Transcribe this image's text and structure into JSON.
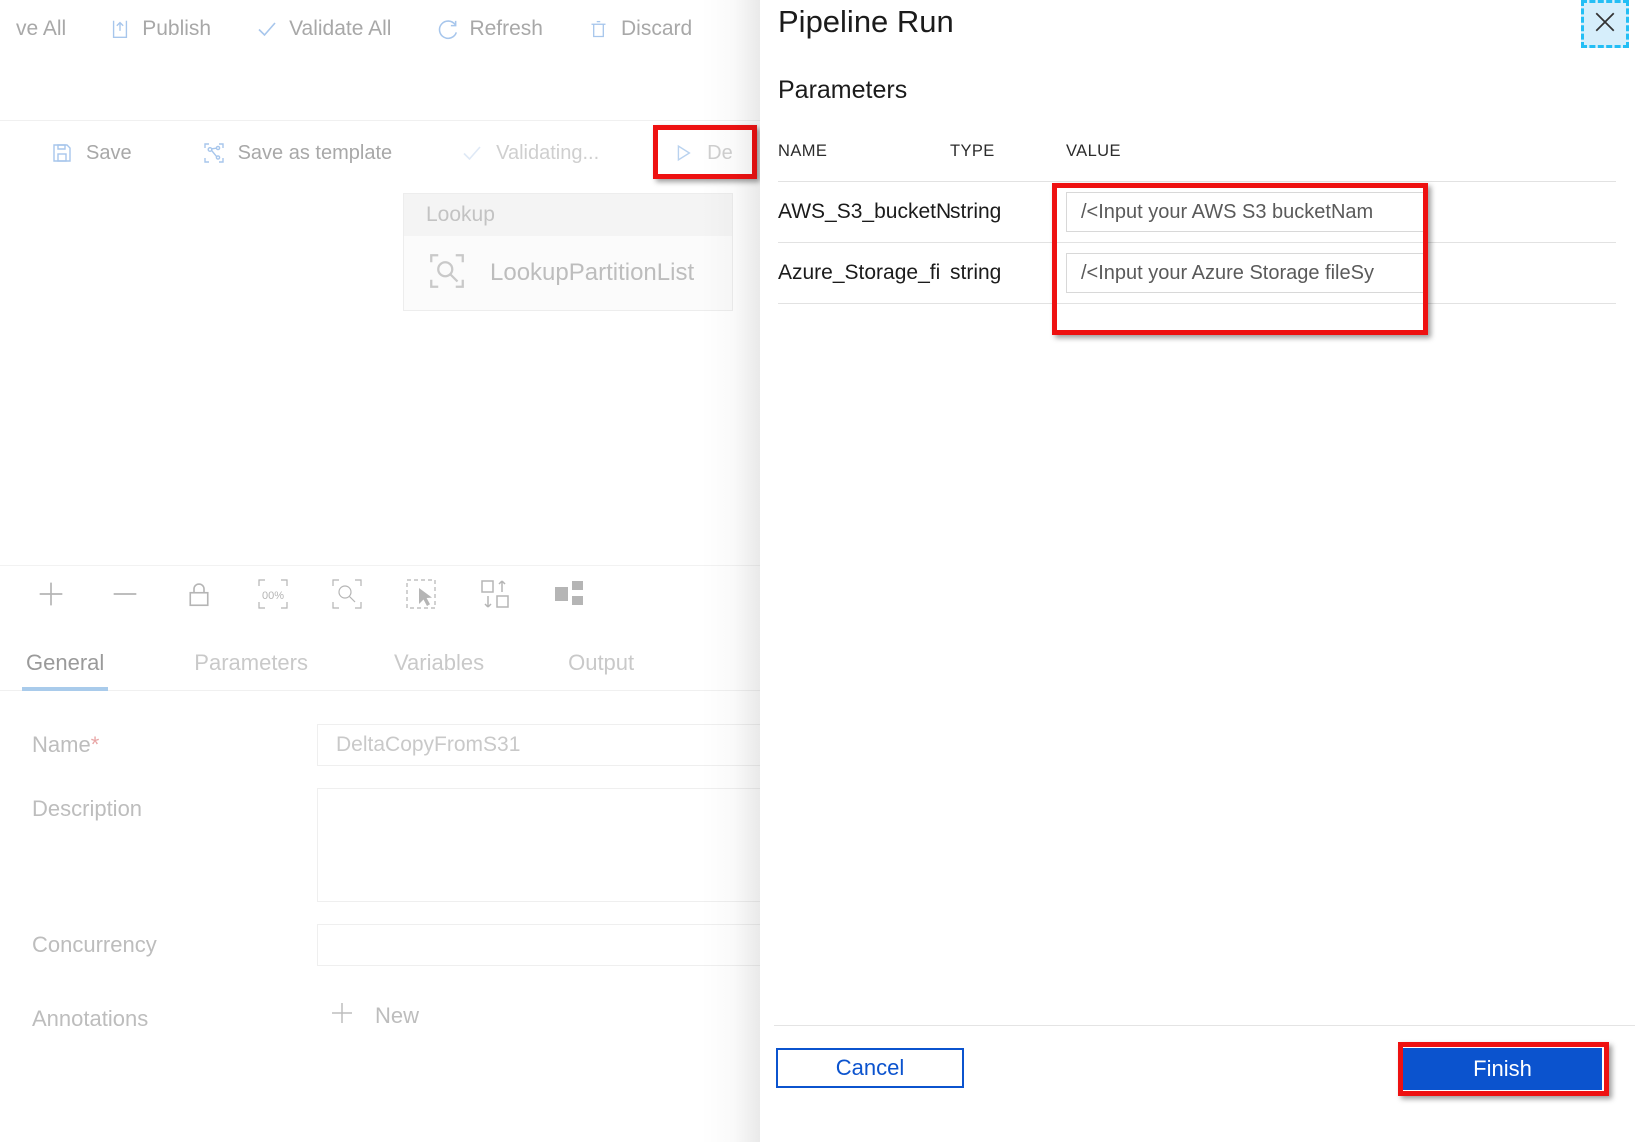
{
  "factory_toolbar": {
    "items": [
      {
        "label": "ve All",
        "icon": "save-all-icon"
      },
      {
        "label": "Publish",
        "icon": "publish-upload-icon"
      },
      {
        "label": "Validate All",
        "icon": "checkmark-icon"
      },
      {
        "label": "Refresh",
        "icon": "refresh-icon"
      },
      {
        "label": "Discard",
        "icon": "trash-icon"
      }
    ]
  },
  "pipeline_toolbar": {
    "items": [
      {
        "label": "Save",
        "icon": "floppy-save-icon",
        "muted": false
      },
      {
        "label": "Save as template",
        "icon": "template-share-icon",
        "muted": false
      },
      {
        "label": "Validating...",
        "icon": "checkmark-icon",
        "muted": true
      },
      {
        "label": "De",
        "icon": "play-triangle-icon",
        "muted": true
      }
    ]
  },
  "canvas": {
    "node": {
      "type_label": "Lookup",
      "name": "LookupPartitionList",
      "icon": "lookup-magnifier-icon"
    },
    "tools": [
      {
        "icon": "zoom-in-plus-icon"
      },
      {
        "icon": "zoom-out-minus-icon"
      },
      {
        "icon": "lock-icon"
      },
      {
        "icon": "zoom-100-percent-icon"
      },
      {
        "icon": "zoom-to-fit-icon"
      },
      {
        "icon": "select-pointer-icon"
      },
      {
        "icon": "auto-align-icon"
      },
      {
        "icon": "layout-nodes-icon"
      }
    ]
  },
  "detail_tabs": {
    "items": [
      {
        "label": "General",
        "active": true
      },
      {
        "label": "Parameters",
        "active": false
      },
      {
        "label": "Variables",
        "active": false
      },
      {
        "label": "Output",
        "active": false
      }
    ]
  },
  "general_form": {
    "name_label": "Name",
    "name_required_mark": "*",
    "name_value": "DeltaCopyFromS31",
    "description_label": "Description",
    "description_value": "",
    "concurrency_label": "Concurrency",
    "concurrency_value": "",
    "annotations_label": "Annotations",
    "annotations_new_label": "New"
  },
  "panel": {
    "title": "Pipeline Run",
    "close_icon": "close-x-icon",
    "section_title": "Parameters",
    "table": {
      "columns": [
        "NAME",
        "TYPE",
        "VALUE"
      ],
      "rows": [
        {
          "name": "AWS_S3_bucketN",
          "type": "string",
          "value": "/<Input your AWS S3 bucketNam"
        },
        {
          "name": "Azure_Storage_fi",
          "type": "string",
          "value": "/<Input your Azure Storage fileSy"
        }
      ]
    },
    "cancel_label": "Cancel",
    "finish_label": "Finish"
  },
  "colors": {
    "highlight_red": "#ee1111",
    "primary_blue": "#0b53ce",
    "focus_cyan": "#23bef5",
    "focus_fill": "#d6eefb",
    "tab_accent": "#a9cbeb"
  }
}
